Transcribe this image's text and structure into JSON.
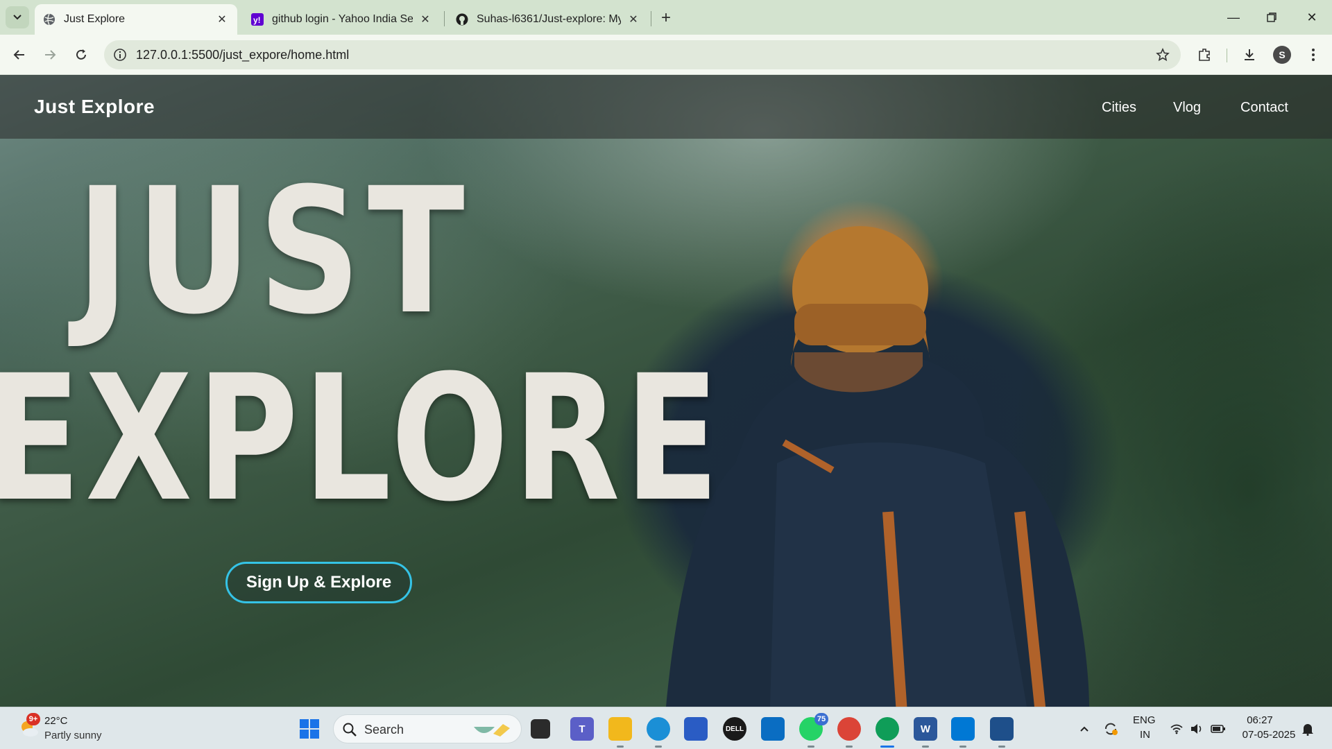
{
  "browser": {
    "tabs": [
      {
        "title": "Just Explore",
        "active": true
      },
      {
        "title": "github login - Yahoo India Sear"
      },
      {
        "title": "Suhas-l6361/Just-explore: My n"
      }
    ],
    "new_tab": "+",
    "address": "127.0.0.1:5500/just_expore/home.html",
    "profile_initial": "S"
  },
  "site": {
    "brand": "Just Explore",
    "nav": [
      {
        "label": "Cities"
      },
      {
        "label": "Vlog"
      },
      {
        "label": "Contact"
      }
    ],
    "hero": {
      "line1": "JUST",
      "line2": "EXPLORE"
    },
    "cta_label": "Sign Up & Explore",
    "colors": {
      "accent": "#35c3e6",
      "nav_text": "#ffffff"
    }
  },
  "taskbar": {
    "weather": {
      "temp": "22°C",
      "desc": "Partly sunny",
      "badge": "9+"
    },
    "search_placeholder": "Search",
    "badges": {
      "whatsapp": "75"
    },
    "tray": {
      "lang1": "ENG",
      "lang2": "IN",
      "time": "06:27",
      "date": "07-05-2025"
    }
  }
}
